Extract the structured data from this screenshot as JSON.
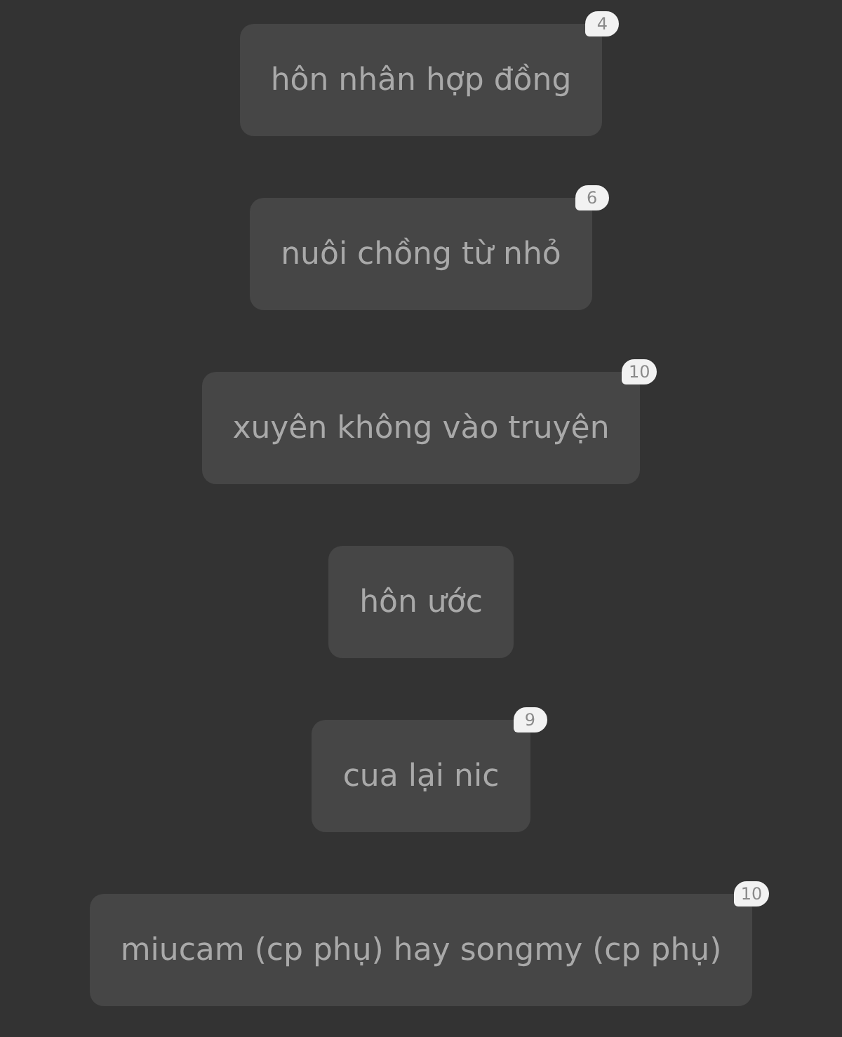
{
  "options": [
    {
      "label": "hôn nhân hợp đồng",
      "count": "4"
    },
    {
      "label": "nuôi chồng từ nhỏ",
      "count": "6"
    },
    {
      "label": "xuyên không vào truyện",
      "count": "10"
    },
    {
      "label": "hôn ước"
    },
    {
      "label": "cua lại nic",
      "count": "9"
    },
    {
      "label": "miucam (cp phụ) hay songmy (cp phụ)",
      "count": "10"
    }
  ]
}
